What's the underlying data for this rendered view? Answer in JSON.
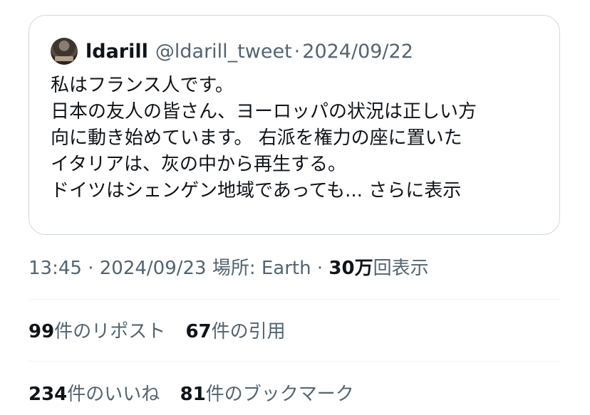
{
  "quote": {
    "author_name": "ldarill",
    "author_handle": "@ldarill_tweet",
    "separator": "·",
    "date": "2024/09/22",
    "lines": [
      "私はフランス人です。",
      "日本の友人の皆さん、ヨーロッパの状況は正しい方",
      "向に動き始めています。 右派を権力の座に置いた",
      "イタリアは、灰の中から再生する。",
      "ドイツはシェンゲン地域であっても..."
    ],
    "show_more": "さらに表示"
  },
  "meta": {
    "time": "13:45",
    "separator": "·",
    "date": "2024/09/23",
    "location": "場所: Earth",
    "views_count": "30万",
    "views_label": "回表示"
  },
  "stats": {
    "reposts_count": "99",
    "reposts_label": "件のリポスト",
    "quotes_count": "67",
    "quotes_label": "件の引用",
    "likes_count": "234",
    "likes_label": "件のいいね",
    "bookmarks_count": "81",
    "bookmarks_label": "件のブックマーク"
  }
}
